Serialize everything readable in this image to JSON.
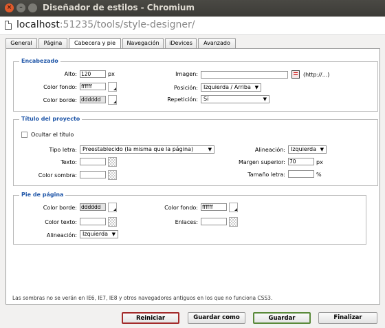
{
  "window": {
    "title": "Diseñador de estilos - Chromium",
    "close_glyph": "×",
    "min_glyph": "–",
    "max_glyph": ""
  },
  "urlbar": {
    "host": "localhost",
    "path": ":51235/tools/style-designer/"
  },
  "tabs": [
    {
      "label": "General"
    },
    {
      "label": "Página"
    },
    {
      "label": "Cabecera y pie",
      "active": true
    },
    {
      "label": "Navegación"
    },
    {
      "label": "iDevices"
    },
    {
      "label": "Avanzado"
    }
  ],
  "header_section": {
    "legend": "Encabezado",
    "height_label": "Alto:",
    "height_value": "120",
    "height_unit": "px",
    "bg_color_label": "Color fondo:",
    "bg_color_value": "ffffff",
    "border_color_label": "Color borde:",
    "border_color_value": "dddddd",
    "image_label": "Imagen:",
    "image_value": "",
    "image_hint": "(http://...)",
    "position_label": "Posición:",
    "position_value": "Izquierda / Arriba",
    "repeat_label": "Repetición:",
    "repeat_value": "Sí"
  },
  "title_section": {
    "legend": "Título del proyecto",
    "hide_title_label": "Ocultar el título",
    "font_label": "Tipo letra:",
    "font_value": "Preestablecido (la misma que la página)",
    "text_label": "Texto:",
    "text_value": "",
    "shadow_label": "Color sombra:",
    "shadow_value": "",
    "align_label": "Alineación:",
    "align_value": "Izquierda",
    "margin_top_label": "Margen superior:",
    "margin_top_value": "70",
    "margin_top_unit": "px",
    "font_size_label": "Tamaño letra:",
    "font_size_value": "",
    "font_size_unit": "%"
  },
  "footer_section": {
    "legend": "Pie de página",
    "border_color_label": "Color borde:",
    "border_color_value": "dddddd",
    "text_color_label": "Color texto:",
    "text_color_value": "",
    "align_label": "Alineación:",
    "align_value": "Izquierda",
    "bg_color_label": "Color fondo:",
    "bg_color_value": "ffffff",
    "links_label": "Enlaces:",
    "links_value": ""
  },
  "note": "Las sombras no se verán en IE6, IE7, IE8 y otros navegadores antiguos en los que no funciona CSS3.",
  "buttons": {
    "reset": "Reiniciar",
    "save_as": "Guardar como",
    "save": "Guardar",
    "finish": "Finalizar"
  },
  "icons": {
    "dropdown": "▼"
  }
}
